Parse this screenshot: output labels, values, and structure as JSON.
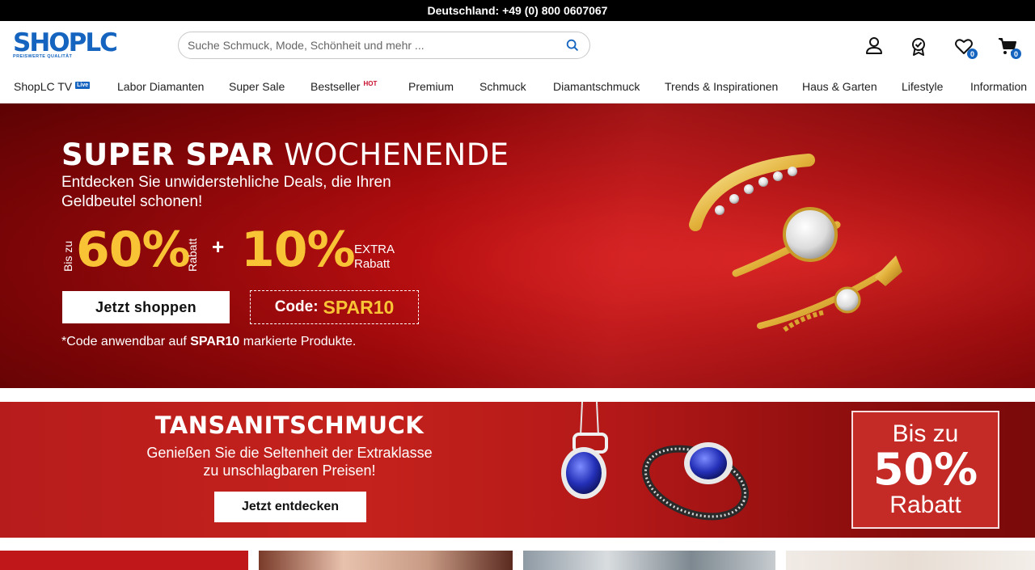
{
  "topbar": {
    "phone_text": "Deutschland: +49 (0) 800 0607067"
  },
  "header": {
    "logo_text": "SHOPLC",
    "logo_tagline": "PREISWERTE QUALITÄT",
    "search_placeholder": "Suche Schmuck, Mode, Schönheit und mehr ...",
    "wishlist_count": "0",
    "cart_count": "0"
  },
  "nav": {
    "items": [
      {
        "label": "ShopLC TV",
        "tag": "Live"
      },
      {
        "label": "Labor Diamanten"
      },
      {
        "label": "Super Sale"
      },
      {
        "label": "Bestseller",
        "tag": "HOT"
      },
      {
        "label": "Premium"
      },
      {
        "label": "Schmuck"
      },
      {
        "label": "Diamantschmuck"
      },
      {
        "label": "Trends & Inspirationen"
      },
      {
        "label": "Haus & Garten"
      },
      {
        "label": "Lifestyle"
      },
      {
        "label": "Information"
      }
    ]
  },
  "hero": {
    "title_bold": "SUPER SPAR",
    "title_light": "WOCHENENDE",
    "subtitle": "Entdecken Sie unwiderstehliche Deals, die Ihren Geldbeutel schonen!",
    "upto": "Bis zu",
    "percent1": "60%",
    "rabatt1": "Rabatt",
    "plus": "+",
    "percent2": "10%",
    "extra_line1": "EXTRA",
    "extra_line2": "Rabatt",
    "shop_button": "Jetzt shoppen",
    "code_label": "Code:",
    "code_value": "SPAR10",
    "note_prefix": "*Code anwendbar auf ",
    "note_code": "SPAR10",
    "note_suffix": " markierte Produkte."
  },
  "banner2": {
    "title": "TANSANITSCHMUCK",
    "subtitle_line1": "Genießen Sie die Seltenheit der Extraklasse",
    "subtitle_line2": "zu unschlagbaren Preisen!",
    "button": "Jetzt entdecken",
    "box_line1": "Bis zu",
    "box_line2": "50%",
    "box_line3": "Rabatt"
  },
  "colors": {
    "brand_blue": "#1565c0",
    "hero_red": "#b50e10",
    "promo_gold": "#f8c436",
    "hot_red": "#c8102e"
  }
}
